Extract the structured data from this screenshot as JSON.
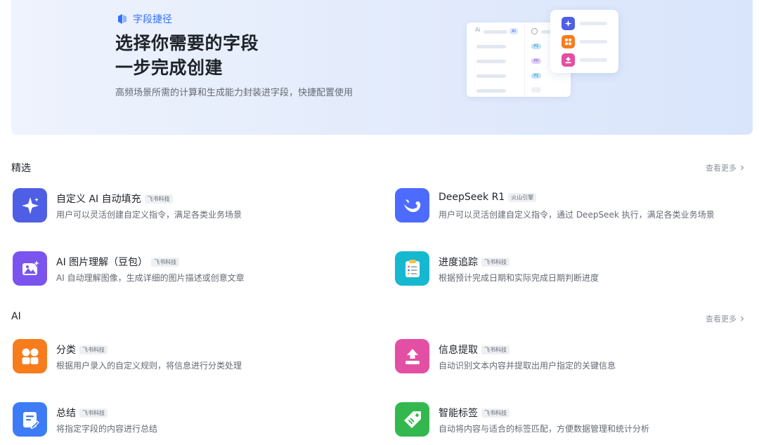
{
  "banner": {
    "brand": "字段捷径",
    "title_line1": "选择你需要的字段",
    "title_line2": "一步完成创建",
    "subtitle": "高频场景所需的计算和生成能力封装进字段，快捷配置使用",
    "illustration": {
      "header_text": "Ai",
      "header_badge": "AI",
      "pills": [
        "P1",
        "P0",
        "P1"
      ]
    }
  },
  "sections": [
    {
      "title": "精选",
      "more": "查看更多",
      "items": [
        {
          "name": "自定义 AI 自动填充",
          "badge": "飞书科技",
          "desc": "用户可以灵活创建自定义指令，满足各类业务场景",
          "icon": "sparkle-icon",
          "color": "#4e5fe6"
        },
        {
          "name": "DeepSeek R1",
          "badge": "火山引擎",
          "desc": "用户可以灵活创建自定义指令，通过 DeepSeek 执行，满足各类业务场景",
          "icon": "whale-icon",
          "color": "#4d6bfe"
        },
        {
          "name": "AI 图片理解（豆包）",
          "badge": "飞书科技",
          "desc": "AI 自动理解图像，生成详细的图片描述或创意文章",
          "icon": "image-sparkle-icon",
          "color": "#7b54f0"
        },
        {
          "name": "进度追踪",
          "badge": "飞书科技",
          "desc": "根据预计完成日期和实际完成日期判断进度",
          "icon": "clipboard-icon",
          "color": "#16b8cf"
        }
      ]
    },
    {
      "title": "AI",
      "more": "查看更多",
      "items": [
        {
          "name": "分类",
          "badge": "飞书科技",
          "desc": "根据用户录入的自定义规则，将信息进行分类处理",
          "icon": "shapes-icon",
          "color": "#f77c1c"
        },
        {
          "name": "信息提取",
          "badge": "飞书科技",
          "desc": "自动识别文本内容并提取出用户指定的关键信息",
          "icon": "extract-icon",
          "color": "#e34fa3"
        },
        {
          "name": "总结",
          "badge": "飞书科技",
          "desc": "将指定字段的内容进行总结",
          "icon": "summary-doc-icon",
          "color": "#3d7cf6"
        },
        {
          "name": "智能标签",
          "badge": "飞书科技",
          "desc": "自动将内容与适合的标签匹配，方便数据管理和统计分析",
          "icon": "tag-icon",
          "color": "#33b84f"
        }
      ]
    }
  ]
}
